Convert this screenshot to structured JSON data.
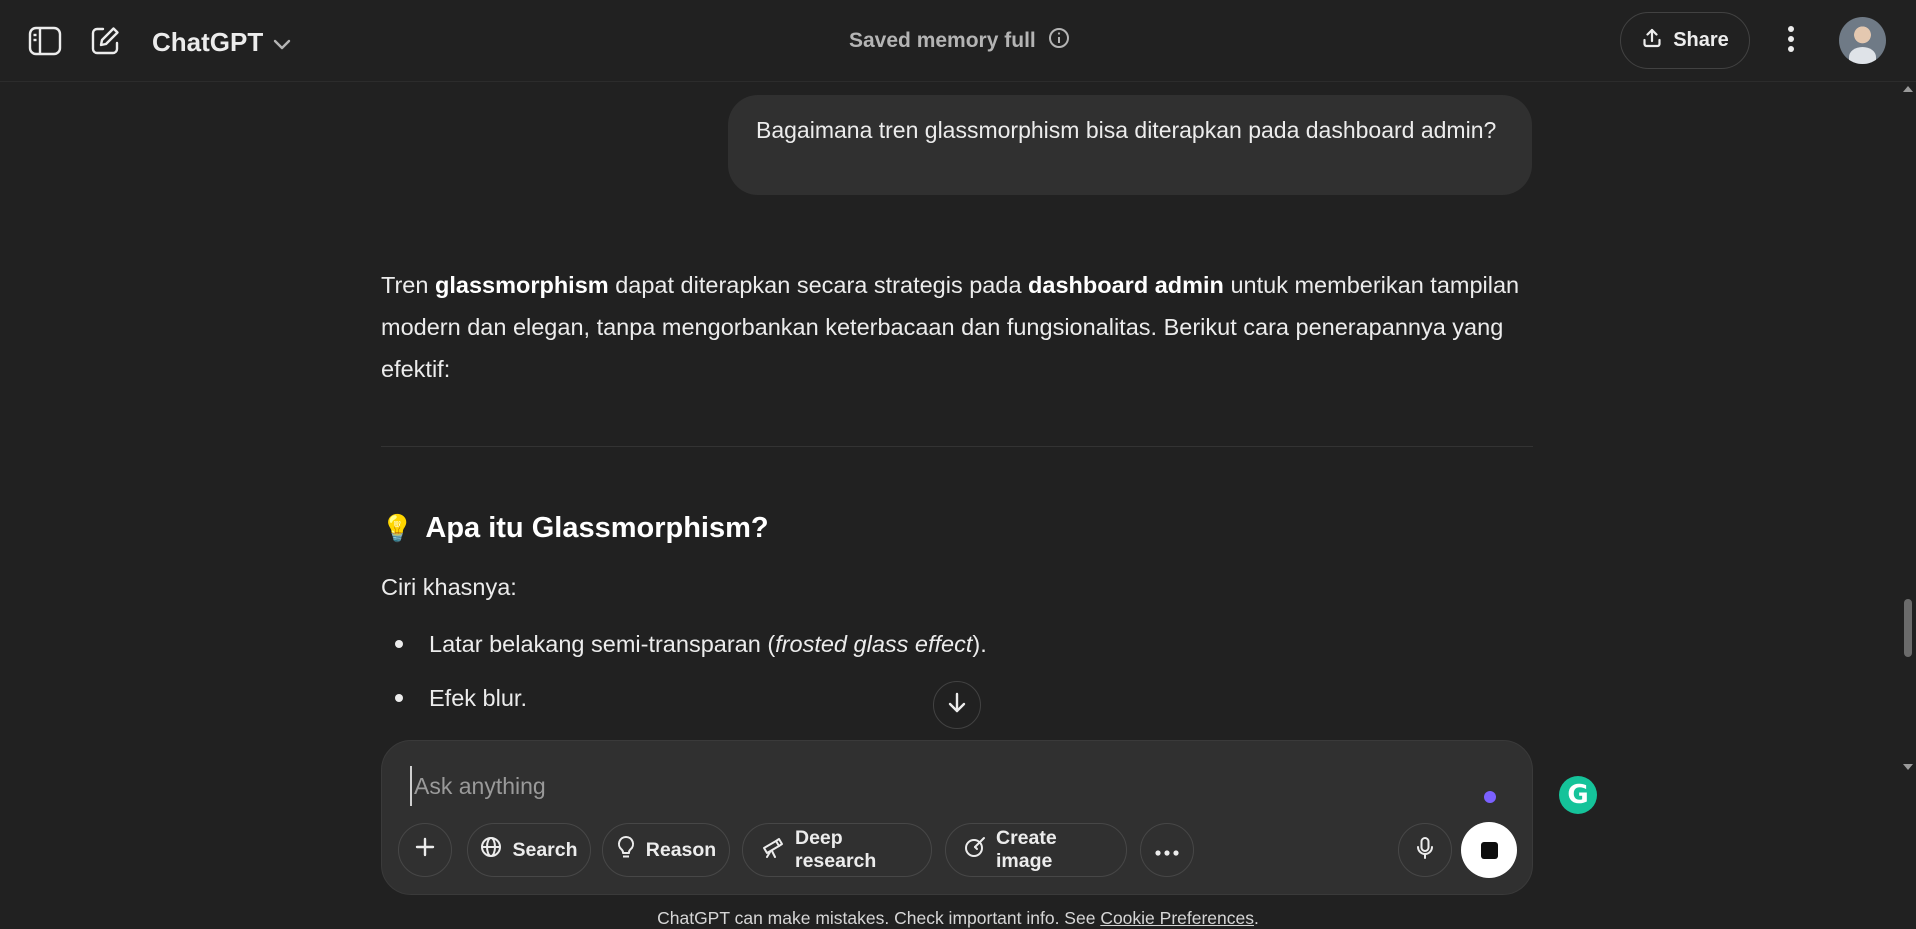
{
  "header": {
    "model_name": "ChatGPT",
    "memory_notice": "Saved memory full",
    "share_label": "Share"
  },
  "conversation": {
    "user_message": "Bagaimana tren glassmorphism bisa diterapkan pada dashboard admin?",
    "intro": {
      "t1": "Tren ",
      "b1": "glassmorphism",
      "t2": " dapat diterapkan secara strategis pada ",
      "b2": "dashboard admin",
      "t3": " untuk memberikan tampilan modern dan elegan, tanpa mengorbankan keterbacaan dan fungsionalitas. Berikut cara penerapannya yang efektif:"
    },
    "section_emoji": "💡",
    "section_title": "Apa itu Glassmorphism?",
    "subheading": "Ciri khasnya:",
    "bullets": {
      "b1_text": "Latar belakang semi-transparan (",
      "b1_italic": "frosted glass effect",
      "b1_end": ").",
      "b2_text": "Efek blur."
    }
  },
  "composer": {
    "placeholder": "Ask anything",
    "tools": {
      "search": "Search",
      "reason": "Reason",
      "deep_research": "Deep research",
      "create_image": "Create image"
    },
    "status_dot_color": "#7b61ff"
  },
  "grammarly_letter": "G",
  "footer": {
    "text": "ChatGPT can make mistakes. Check important info. See ",
    "link": "Cookie Preferences",
    "end": "."
  },
  "colors": {
    "background": "#212121",
    "bubble": "#303030",
    "text": "#ececec"
  }
}
